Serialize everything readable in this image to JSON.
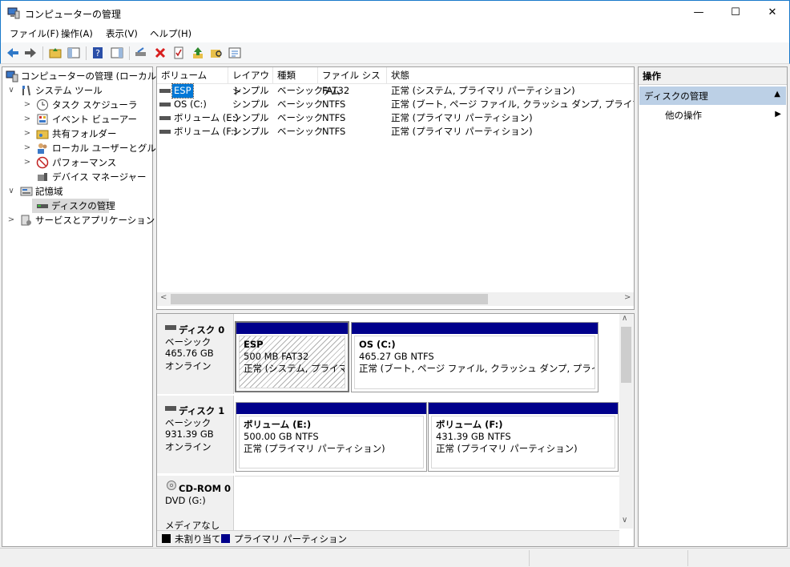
{
  "window": {
    "title": "コンピューターの管理"
  },
  "menu": [
    "ファイル(F)",
    "操作(A)",
    "表示(V)",
    "ヘルプ(H)"
  ],
  "tree": {
    "root": "コンピューターの管理 (ローカル)",
    "system_tools": "システム ツール",
    "task_scheduler": "タスク スケジューラ",
    "event_viewer": "イベント ビューアー",
    "shared_folders": "共有フォルダー",
    "local_users": "ローカル ユーザーとグループ",
    "performance": "パフォーマンス",
    "device_manager": "デバイス マネージャー",
    "storage": "記憶域",
    "disk_management": "ディスクの管理",
    "services_apps": "サービスとアプリケーション"
  },
  "list": {
    "headers": [
      "ボリューム",
      "レイアウト",
      "種類",
      "ファイル システム",
      "状態"
    ],
    "rows": [
      [
        "ESP",
        "シンプル",
        "ベーシック",
        "FAT32",
        "正常 (システム, プライマリ パーティション)"
      ],
      [
        "OS (C:)",
        "シンプル",
        "ベーシック",
        "NTFS",
        "正常 (ブート, ページ ファイル, クラッシュ ダンプ, プライマリ パーティション)"
      ],
      [
        "ボリューム (E:)",
        "シンプル",
        "ベーシック",
        "NTFS",
        "正常 (プライマリ パーティション)"
      ],
      [
        "ボリューム (F:)",
        "シンプル",
        "ベーシック",
        "NTFS",
        "正常 (プライマリ パーティション)"
      ]
    ]
  },
  "disks": {
    "disk0": {
      "name": "ディスク 0",
      "type": "ベーシック",
      "size": "465.76 GB",
      "status": "オンライン",
      "p1": {
        "name": "ESP",
        "size": "500 MB FAT32",
        "status": "正常 (システム, プライマリ パ"
      },
      "p2": {
        "name": "OS  (C:)",
        "size": "465.27 GB NTFS",
        "status": "正常 (ブート, ページ ファイル, クラッシュ ダンプ, プライマリ パーティ"
      }
    },
    "disk1": {
      "name": "ディスク 1",
      "type": "ベーシック",
      "size": "931.39 GB",
      "status": "オンライン",
      "p1": {
        "name": "ボリューム  (E:)",
        "size": "500.00 GB NTFS",
        "status": "正常 (プライマリ パーティション)"
      },
      "p2": {
        "name": "ボリューム  (F:)",
        "size": "431.39 GB NTFS",
        "status": "正常 (プライマリ パーティション)"
      }
    },
    "cdrom": {
      "name": "CD-ROM 0",
      "type": "DVD (G:)",
      "media": "メディアなし"
    }
  },
  "legend": {
    "unallocated": "未割り当て",
    "primary": "プライマリ パーティション"
  },
  "action_pane": {
    "header": "操作",
    "section": "ディスクの管理",
    "more": "他の操作"
  },
  "colors": {
    "partition_bar": "#00008b",
    "accent": "#1979ca",
    "section_bg": "#bcd0e6"
  }
}
